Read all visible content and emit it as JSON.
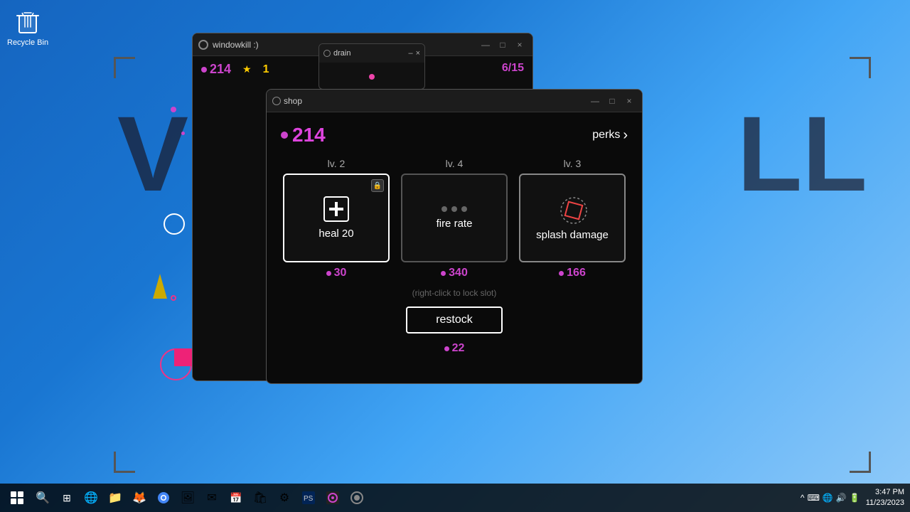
{
  "desktop": {
    "recycle_bin_label": "Recycle Bin"
  },
  "background_game": {
    "title": "windowkill :)",
    "hp": "214",
    "level": "1",
    "hp_right": "6/15"
  },
  "drain_window": {
    "title": "drain",
    "minimize_label": "–",
    "close_label": "×"
  },
  "main_game": {
    "title": "windowkill :)",
    "hp": "214",
    "level": "1",
    "controls": {
      "minimize": "—",
      "maximize": "□",
      "close": "×"
    }
  },
  "shop": {
    "title": "shop",
    "currency": "214",
    "perks_label": "perks",
    "items": [
      {
        "level": "lv. 2",
        "name": "heal 20",
        "price": "30",
        "locked": true,
        "icon_type": "heal"
      },
      {
        "level": "lv. 4",
        "name": "fire rate",
        "price": "340",
        "locked": false,
        "icon_type": "fire_rate"
      },
      {
        "level": "lv. 3",
        "name": "splash damage",
        "price": "166",
        "locked": false,
        "icon_type": "splash"
      }
    ],
    "hint": "(right-click to lock slot)",
    "restock_label": "restock",
    "restock_price": "22",
    "controls": {
      "minimize": "—",
      "maximize": "□",
      "close": "×"
    }
  },
  "taskbar": {
    "time": "3:47 PM",
    "date": "11/23/2023",
    "apps": [
      {
        "name": "search",
        "icon": "🔍"
      },
      {
        "name": "task-view",
        "icon": "⊞"
      },
      {
        "name": "edge",
        "icon": "🌐"
      },
      {
        "name": "explorer",
        "icon": "📁"
      },
      {
        "name": "firefox",
        "icon": "🦊"
      },
      {
        "name": "chrome",
        "icon": "🌐"
      },
      {
        "name": "photos",
        "icon": "🖼"
      },
      {
        "name": "mail",
        "icon": "✉"
      },
      {
        "name": "calendar",
        "icon": "📅"
      },
      {
        "name": "store",
        "icon": "🛍"
      },
      {
        "name": "settings",
        "icon": "⚙"
      },
      {
        "name": "terminal",
        "icon": "⬛"
      },
      {
        "name": "app1",
        "icon": "🎮"
      },
      {
        "name": "app2",
        "icon": "🔵"
      },
      {
        "name": "circle-app",
        "icon": "⚫"
      }
    ]
  }
}
